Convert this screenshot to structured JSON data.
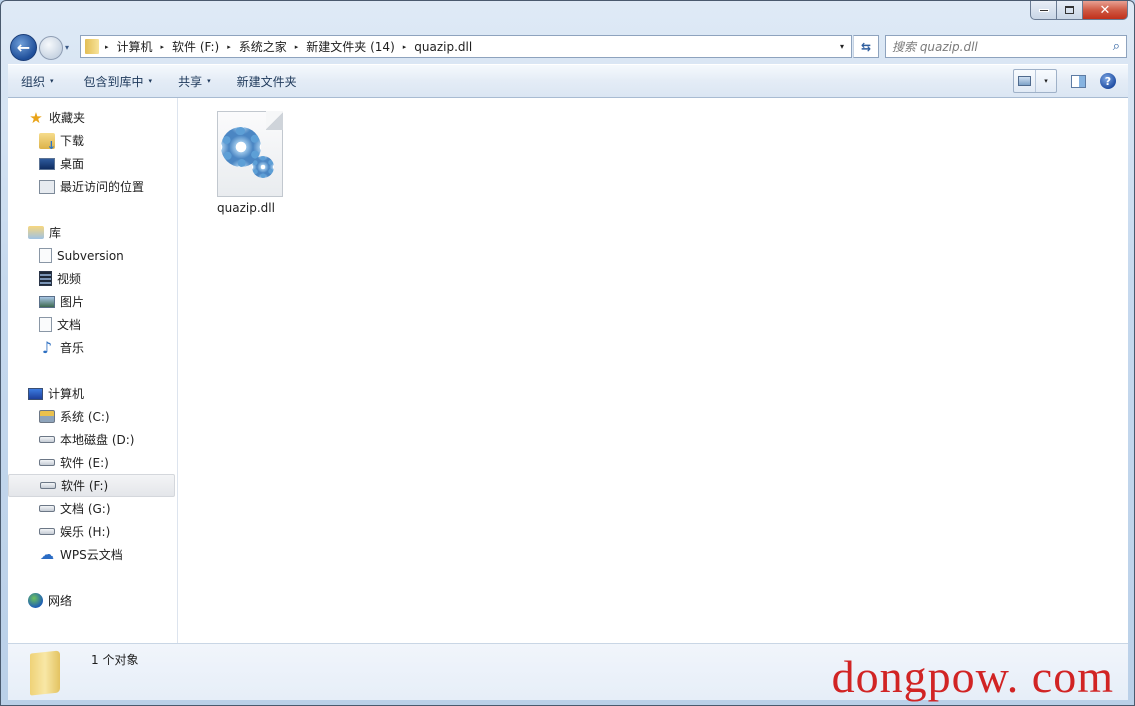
{
  "window": {
    "caption_buttons": {
      "minimize": "—",
      "maximize": "□",
      "close": "✕"
    }
  },
  "nav": {
    "back_icon": "←",
    "forward_icon": "→",
    "history_dropdown": "▾"
  },
  "address_bar": {
    "breadcrumbs": [
      "计算机",
      "软件 (F:)",
      "系统之家",
      "新建文件夹 (14)",
      "quazip.dll"
    ],
    "separator": "▸",
    "dropdown": "▾",
    "refresh_icon": "⇆"
  },
  "search": {
    "placeholder": "搜索 quazip.dll",
    "icon": "⌕"
  },
  "toolbar": {
    "organize": "组织",
    "include_in_library": "包含到库中",
    "share": "共享",
    "new_folder": "新建文件夹",
    "arrow": "▾",
    "help": "?"
  },
  "sidebar": {
    "favorites": {
      "label": "收藏夹",
      "items": [
        "下载",
        "桌面",
        "最近访问的位置"
      ]
    },
    "libraries": {
      "label": "库",
      "items": [
        "Subversion",
        "视频",
        "图片",
        "文档",
        "音乐"
      ]
    },
    "computer": {
      "label": "计算机",
      "items": [
        "系统 (C:)",
        "本地磁盘 (D:)",
        "软件 (E:)",
        "软件 (F:)",
        "文档 (G:)",
        "娱乐 (H:)",
        "WPS云文档"
      ],
      "selected": "软件 (F:)"
    },
    "network": {
      "label": "网络"
    }
  },
  "files": [
    {
      "name": "quazip.dll",
      "type": "dll"
    }
  ],
  "status": {
    "text": "1 个对象"
  },
  "watermark": "dongpow. com"
}
